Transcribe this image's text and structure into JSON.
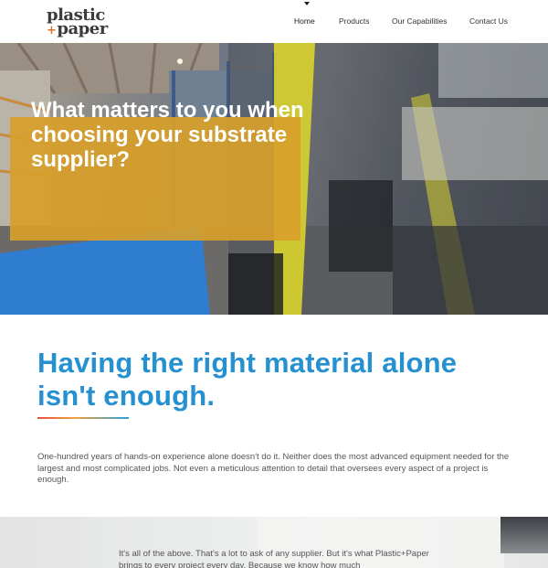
{
  "header": {
    "logo_line1": "plastic",
    "logo_plus": "+",
    "logo_line2": "paper",
    "nav": [
      {
        "label": "Home"
      },
      {
        "label": "Products"
      },
      {
        "label": "Our Capabilities"
      },
      {
        "label": "Contact Us"
      }
    ]
  },
  "hero": {
    "title": "What matters to you when choosing your substrate supplier?"
  },
  "intro": {
    "heading": "Having the right material alone isn't enough.",
    "body": "One-hundred years of hands-on experience alone doesn't do it. Neither does the most advanced equipment needed for the largest and most complicated jobs. Not even a meticulous attention to detail that oversees every aspect of a project is enough."
  },
  "band": {
    "text": "It's all of the above. That's a lot to ask of any supplier. But it's what Plastic+Paper brings to every project every day. Because we know how much"
  },
  "colors": {
    "accent_blue": "#2691d0",
    "hero_box": "#d8a02a",
    "logo_plus": "#e0762b"
  }
}
